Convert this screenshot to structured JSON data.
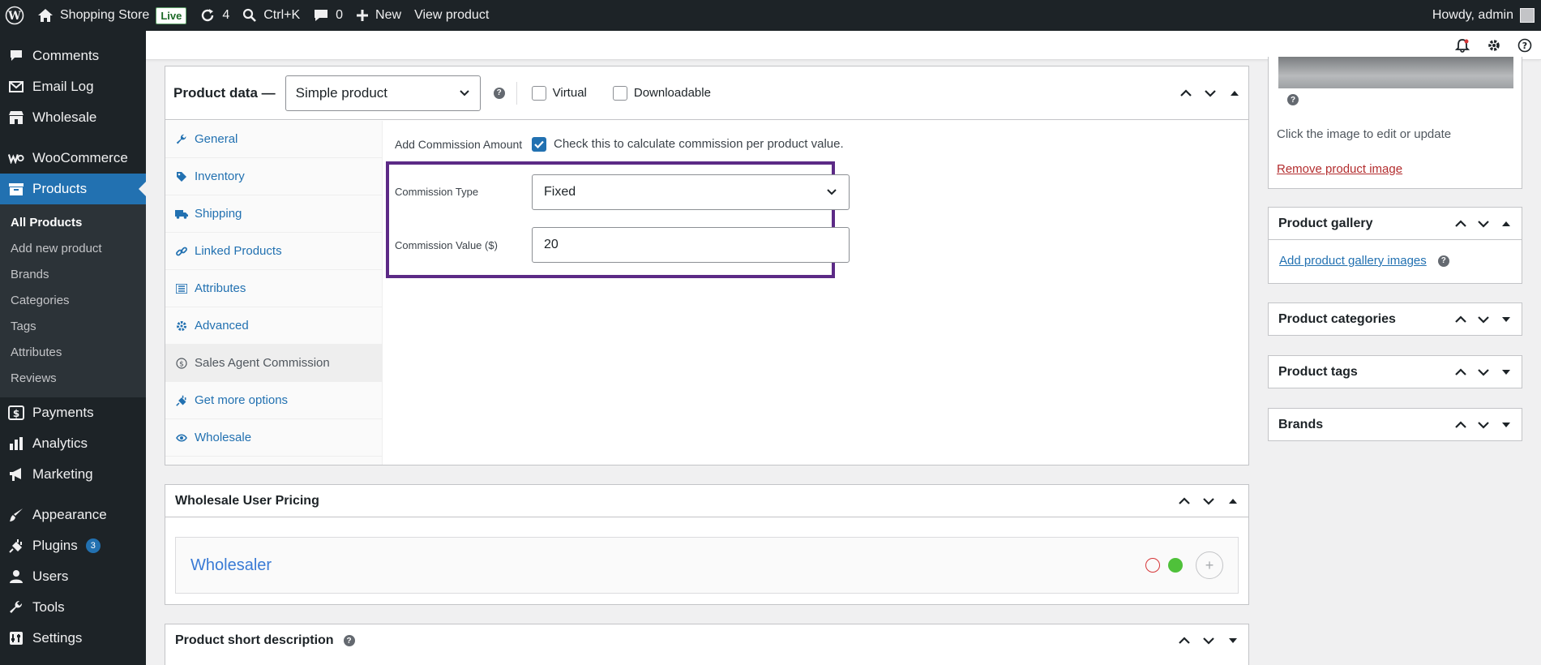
{
  "admin_bar": {
    "site_name": "Shopping Store",
    "live_badge": "Live",
    "updates_count": "4",
    "search_shortcut": "Ctrl+K",
    "comments_count": "0",
    "new_label": "New",
    "view_product": "View product",
    "howdy": "Howdy, admin"
  },
  "sidebar": {
    "items_top": [
      {
        "label": "Comments",
        "icon": "comment-icon"
      },
      {
        "label": "Email Log",
        "icon": "email-icon"
      },
      {
        "label": "Wholesale",
        "icon": "store-icon"
      },
      {
        "label": "WooCommerce",
        "icon": "woocommerce-icon"
      }
    ],
    "products_label": "Products",
    "submenu": [
      "All Products",
      "Add new product",
      "Brands",
      "Categories",
      "Tags",
      "Attributes",
      "Reviews"
    ],
    "items_bottom": [
      {
        "label": "Payments",
        "icon": "payments-icon"
      },
      {
        "label": "Analytics",
        "icon": "analytics-icon"
      },
      {
        "label": "Marketing",
        "icon": "megaphone-icon"
      },
      {
        "label": "Appearance",
        "icon": "paintbrush-icon"
      },
      {
        "label": "Plugins",
        "icon": "plugin-icon"
      },
      {
        "label": "Users",
        "icon": "user-icon"
      },
      {
        "label": "Tools",
        "icon": "wrench-icon"
      },
      {
        "label": "Settings",
        "icon": "settings-icon"
      }
    ],
    "plugins_badge": "3"
  },
  "product_data": {
    "title": "Product data —",
    "type_selected": "Simple product",
    "virtual_label": "Virtual",
    "downloadable_label": "Downloadable",
    "tabs": [
      {
        "label": "General",
        "icon": "wrench-icon"
      },
      {
        "label": "Inventory",
        "icon": "tag-icon"
      },
      {
        "label": "Shipping",
        "icon": "truck-icon"
      },
      {
        "label": "Linked Products",
        "icon": "link-icon"
      },
      {
        "label": "Attributes",
        "icon": "list-icon"
      },
      {
        "label": "Advanced",
        "icon": "gear-icon"
      },
      {
        "label": "Sales Agent Commission",
        "icon": "dollar-circle-icon"
      },
      {
        "label": "Get more options",
        "icon": "plugin-icon"
      },
      {
        "label": "Wholesale",
        "icon": "eye-icon"
      }
    ],
    "active_tab": "Sales Agent Commission",
    "add_commission_label": "Add Commission Amount",
    "add_commission_checked": true,
    "add_commission_desc": "Check this to calculate commission per product value.",
    "commission_type_label": "Commission Type",
    "commission_type_value": "Fixed",
    "commission_value_label": "Commission Value ($)",
    "commission_value": "20"
  },
  "wholesale_pricing": {
    "title": "Wholesale User Pricing",
    "role": "Wholesaler"
  },
  "short_description": {
    "title": "Product short description"
  },
  "right_column": {
    "image_hint": "Click the image to edit or update",
    "remove_image": "Remove product image",
    "gallery_title": "Product gallery",
    "gallery_link": "Add product gallery images",
    "categories_title": "Product categories",
    "tags_title": "Product tags",
    "brands_title": "Brands"
  },
  "colors": {
    "accent": "#2271b1",
    "highlight_border": "#5c2a86",
    "admin_dark": "#1d2327"
  }
}
